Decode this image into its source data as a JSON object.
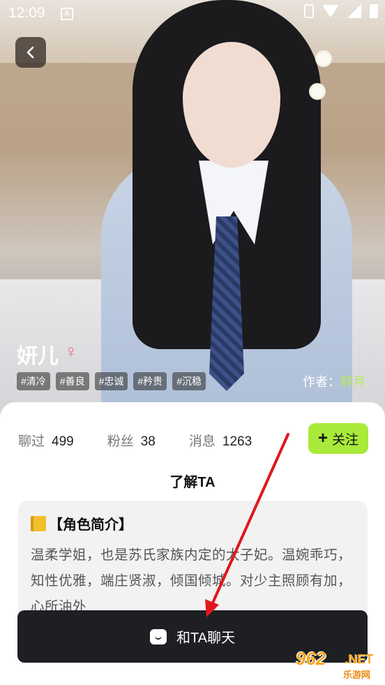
{
  "status_bar": {
    "time": "12:09",
    "notification_badge": "A"
  },
  "header": {
    "back_icon": "chevron-left-icon"
  },
  "character": {
    "name": "妍儿",
    "gender_symbol": "♀",
    "tags": [
      "#清冷",
      "#善良",
      "#忠诚",
      "#矜贵",
      "#沉稳"
    ],
    "author_label": "作者：",
    "author_name": "醉月"
  },
  "stats": [
    {
      "label": "聊过",
      "value": "499"
    },
    {
      "label": "粉丝",
      "value": "38"
    },
    {
      "label": "消息",
      "value": "1263"
    }
  ],
  "follow_button": {
    "plus": "+",
    "label": "关注"
  },
  "section_title": "了解TA",
  "intro": {
    "heading": "【角色简介】",
    "text": "温柔学姐，也是苏氏家族内定的太子妃。温婉乖巧，知性优雅，端庄贤淑，倾国倾城。对少主照顾有加，心所油外"
  },
  "chat_button": {
    "label": "和TA聊天"
  },
  "watermark": {
    "number": "962",
    "suffix": ".NET",
    "sub": "乐游网"
  },
  "colors": {
    "accent": "#a9ea3a",
    "author": "#b8e85a",
    "gender": "#f06a8c",
    "dark_button": "#1d1f22",
    "arrow": "#e0161e"
  }
}
